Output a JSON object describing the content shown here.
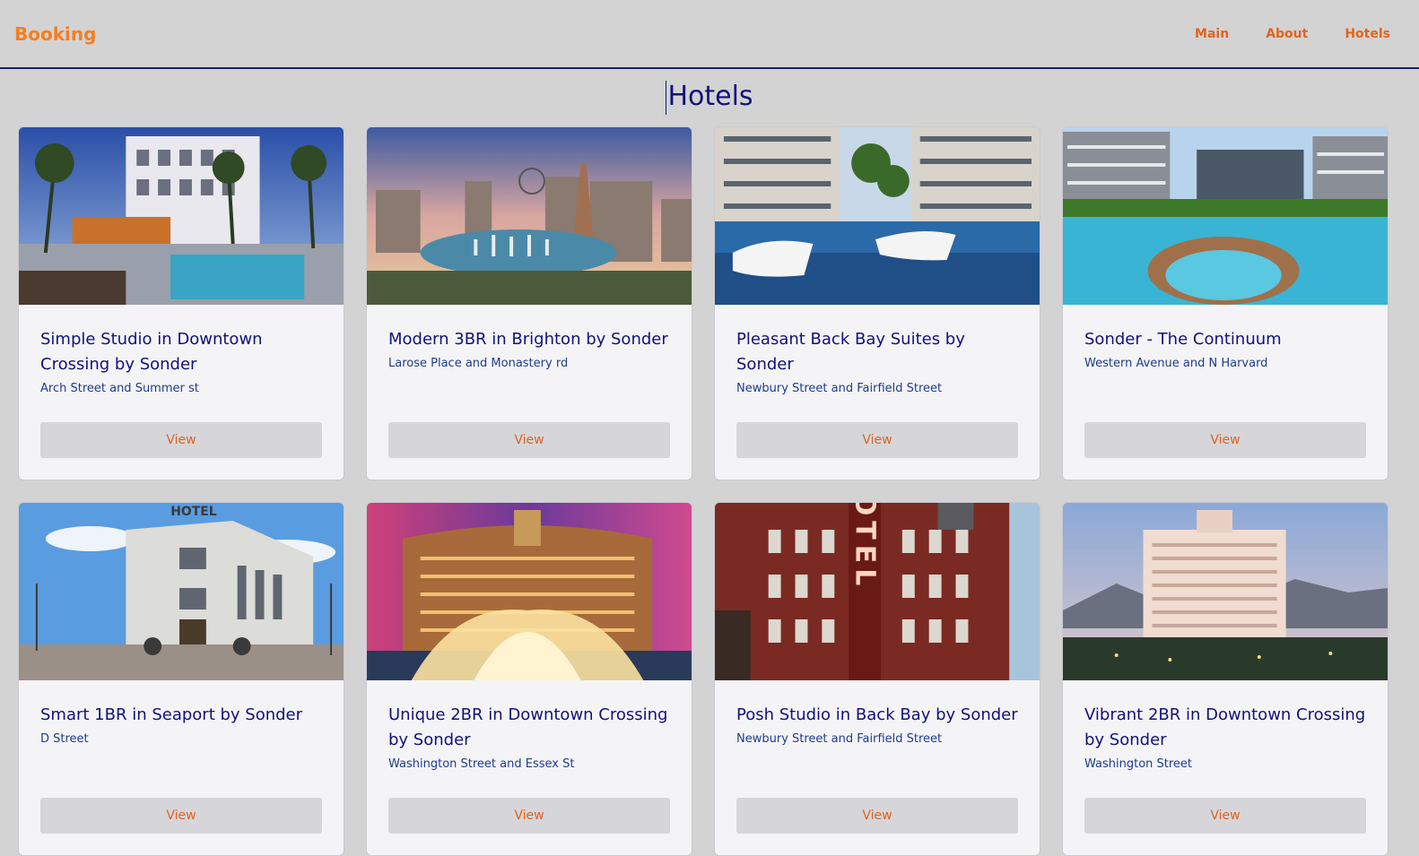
{
  "nav": {
    "brand": "Booking",
    "links": [
      "Main",
      "About",
      "Hotels"
    ]
  },
  "page": {
    "title": "Hotels"
  },
  "hotels": [
    {
      "name": "Simple Studio in Downtown Crossing by Sonder",
      "address": "Arch Street and Summer st",
      "button": "View"
    },
    {
      "name": "Modern 3BR in Brighton by Sonder",
      "address": "Larose Place and Monastery rd",
      "button": "View"
    },
    {
      "name": "Pleasant Back Bay Suites by Sonder",
      "address": "Newbury Street and Fairfield Street",
      "button": "View"
    },
    {
      "name": "Sonder - The Continuum",
      "address": "Western Avenue and N Harvard",
      "button": "View"
    },
    {
      "name": "Smart 1BR in Seaport by Sonder",
      "address": "D Street",
      "button": "View"
    },
    {
      "name": "Unique 2BR in Downtown Crossing by Sonder",
      "address": "Washington Street and Essex St",
      "button": "View"
    },
    {
      "name": "Posh Studio in Back Bay by Sonder",
      "address": "Newbury Street and Fairfield Street",
      "button": "View"
    },
    {
      "name": "Vibrant 2BR in Downtown Crossing by Sonder",
      "address": "Washington Street",
      "button": "View"
    }
  ],
  "image_signs": {
    "hotel_sign_1": "HOTEL",
    "hotel_sign_2": "HOTEL"
  },
  "colors": {
    "brand": "#f47f20",
    "title": "#12127a",
    "link": "#e0641e"
  }
}
